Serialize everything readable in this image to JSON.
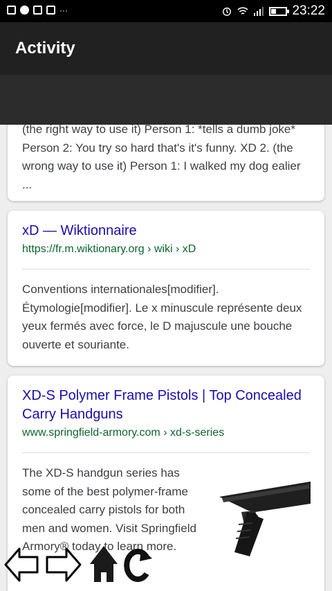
{
  "status_bar": {
    "time": "23:22",
    "dots": "···"
  },
  "app_bar": {
    "title": "Activity"
  },
  "results": [
    {
      "snippet": "(the right way to use it) Person 1: *tells a dumb joke* Person 2: You try so hard that's it's funny. XD 2. (the wrong way to use it) Person 1: I walked my dog ealier ..."
    },
    {
      "title": "xD — Wiktionnaire",
      "url": "https://fr.m.wiktionary.org › wiki › xD",
      "snippet": "Conventions internationales[modifier]. Étymologie[modifier]. Le x minuscule représente deux yeux fermés avec force, le D majuscule une bouche ouverte et souriante."
    },
    {
      "title": "XD-S Polymer Frame Pistols | Top Concealed Carry Handguns",
      "url": "www.springfield-armory.com › xd-s-series",
      "snippet": "The XD-S handgun series has some of the best polymer-frame concealed carry pistols for both men and women. Visit Springfield Armory® today to learn more."
    }
  ],
  "nav_overlay": {
    "icons": [
      "back-arrow-icon",
      "forward-arrow-icon",
      "home-icon",
      "refresh-icon"
    ]
  },
  "colors": {
    "title_link": "#1a0dab",
    "url_green": "#0d652d",
    "app_bar": "#212121"
  }
}
